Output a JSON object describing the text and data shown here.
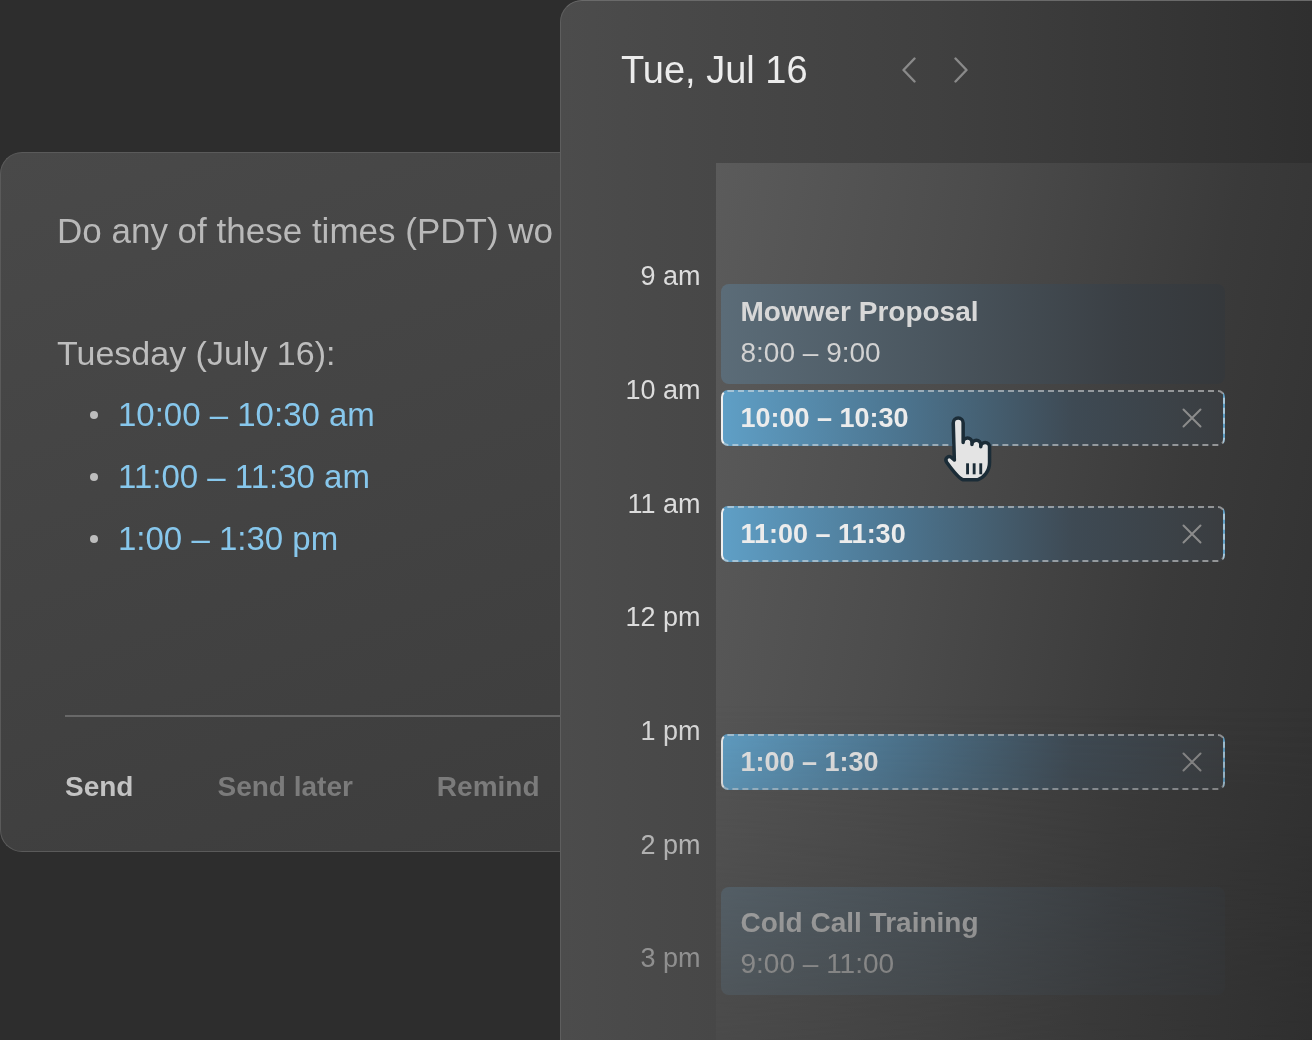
{
  "email": {
    "message": "Do any of these times (PDT) wo",
    "day_heading": "Tuesday (July 16):",
    "time_options": [
      "10:00 – 10:30 am",
      "11:00 – 11:30 am",
      "1:00 – 1:30 pm"
    ],
    "actions": [
      {
        "label": "Send",
        "kind": "primary"
      },
      {
        "label": "Send later",
        "kind": "secondary"
      },
      {
        "label": "Remind",
        "kind": "secondary"
      }
    ]
  },
  "calendar": {
    "date": "Tue, Jul 16",
    "hours": [
      "9 am",
      "10 am",
      "11 am",
      "12 pm",
      "1 pm",
      "2 pm",
      "3 pm"
    ],
    "events": [
      {
        "kind": "event",
        "title": "Mowwer Proposal",
        "time": "8:00 – 9:00"
      },
      {
        "kind": "proposed",
        "time": "10:00 – 10:30",
        "hovered": true
      },
      {
        "kind": "proposed",
        "time": "11:00 – 11:30",
        "hovered": false
      },
      {
        "kind": "proposed",
        "time": "1:00 – 1:30",
        "hovered": false
      },
      {
        "kind": "event",
        "title": "Cold Call Training",
        "time": "9:00 – 11:00"
      }
    ]
  }
}
